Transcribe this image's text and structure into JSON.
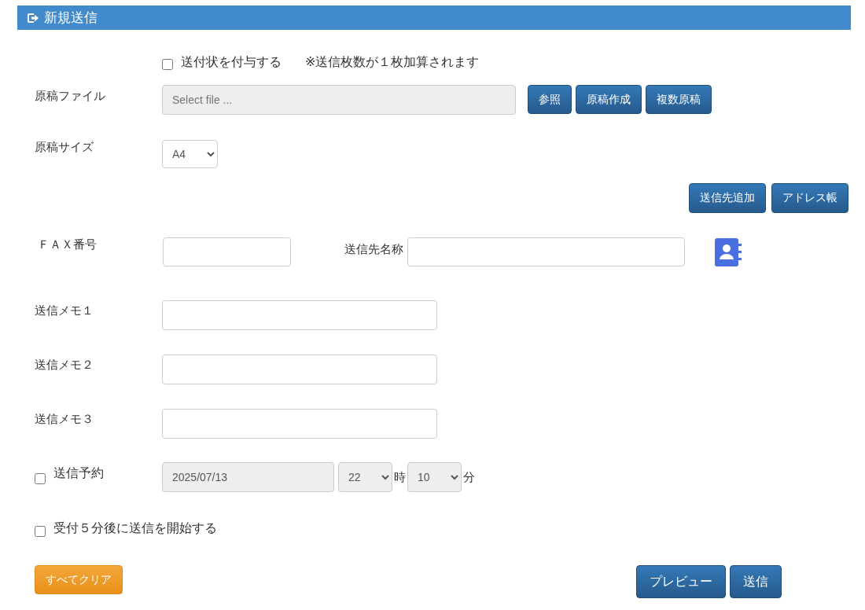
{
  "header": {
    "title": "新規送信"
  },
  "cover_letter": {
    "label": "送付状を付与する",
    "checked": false,
    "note": "※送信枚数が１枚加算されます"
  },
  "file": {
    "label": "原稿ファイル",
    "placeholder": "Select file ...",
    "buttons": [
      "参照",
      "原稿作成",
      "複数原稿"
    ]
  },
  "size": {
    "label": "原稿サイズ",
    "value": "A4"
  },
  "recipient_buttons": [
    "送信先追加",
    "アドレス帳"
  ],
  "fax": {
    "label": "ＦＡＸ番号",
    "name_label": "送信先名称"
  },
  "memos": [
    {
      "label": "送信メモ１"
    },
    {
      "label": "送信メモ２"
    },
    {
      "label": "送信メモ３"
    }
  ],
  "schedule": {
    "label": "送信予約",
    "checked": false,
    "date": "2025/07/13",
    "hour": "22",
    "hour_unit": "時",
    "minute": "10",
    "minute_unit": "分"
  },
  "delay": {
    "label": "受付５分後に送信を開始する",
    "checked": false
  },
  "clear_button": "すべてクリア",
  "actions": [
    "プレビュー",
    "送信"
  ]
}
